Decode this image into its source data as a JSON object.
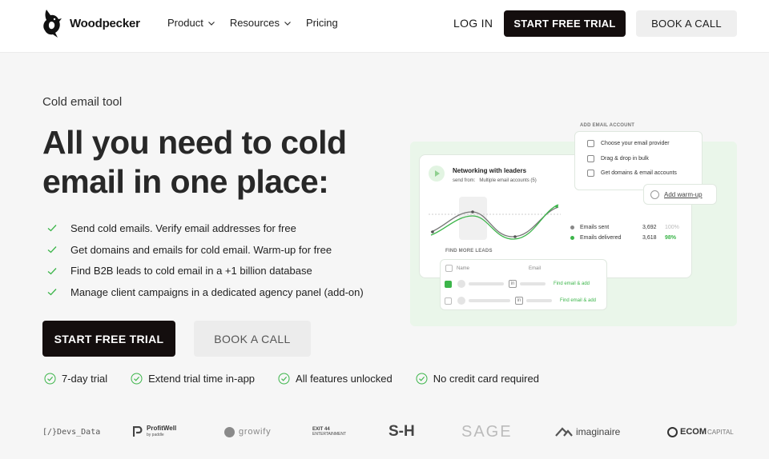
{
  "brand": {
    "name": "Woodpecker"
  },
  "nav": {
    "items": [
      {
        "label": "Product",
        "has_dropdown": true,
        "icon": "chevron-down-icon"
      },
      {
        "label": "Resources",
        "has_dropdown": true,
        "icon": "chevron-down-icon"
      },
      {
        "label": "Pricing",
        "has_dropdown": false
      }
    ],
    "login": "LOG IN",
    "trial": "START FREE TRIAL",
    "call": "BOOK A CALL"
  },
  "hero": {
    "eyebrow": "Cold email tool",
    "headline": "All you need to cold email in one place:",
    "features": [
      "Send cold emails. Verify email addresses for free",
      "Get domains and emails for cold email. Warm-up for free",
      "Find B2B leads to cold email in a +1 billion database",
      "Manage client campaigns in a dedicated agency panel (add-on)"
    ],
    "cta_primary": "START FREE TRIAL",
    "cta_secondary": "BOOK A CALL",
    "badges": [
      "7-day trial",
      "Extend trial time in-app",
      "All features unlocked",
      "No credit card required"
    ]
  },
  "illustration": {
    "campaign": {
      "title": "Networking with leaders",
      "send_from_label": "send from:",
      "send_from_value": "Multiple email accounts (5)"
    },
    "stats": [
      {
        "label": "Emails sent",
        "value": "3,692",
        "pct": "100%",
        "color": "#888888"
      },
      {
        "label": "Emails delivered",
        "value": "3,618",
        "pct": "98%",
        "color": "#3cb54a"
      }
    ],
    "add_account": {
      "title": "ADD EMAIL ACCOUNT",
      "items": [
        "Choose your email provider",
        "Drag & drop in bulk",
        "Get domains & email accounts"
      ]
    },
    "warmup": "Add warm-up",
    "find_leads": {
      "title": "FIND MORE LEADS",
      "col_name": "Name",
      "col_email": "Email",
      "link_label": "Find email & add"
    }
  },
  "logos": [
    "[/}Devs_Data",
    "ProfitWell",
    "by paddle",
    "growify",
    "EXIT 44",
    "ENTERTAINMENT",
    "S-H",
    "SAGE",
    "imaginaire",
    "ECOM",
    "CAPITAL"
  ],
  "colors": {
    "accent": "#3cb54a",
    "dark": "#140e0e",
    "headline": "#282828"
  }
}
